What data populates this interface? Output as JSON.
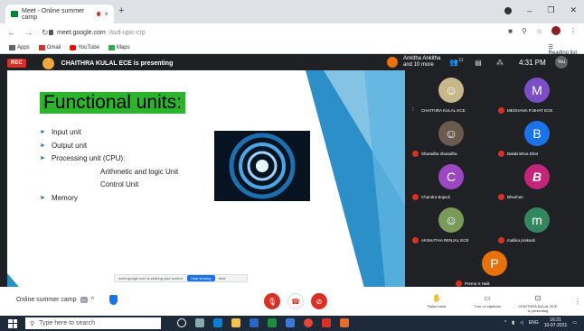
{
  "browser": {
    "tab_title": "Meet - Online summer camp",
    "url": "meet.google.com",
    "url_path": "/svd-upic-crp",
    "bookmarks": [
      {
        "label": "Apps",
        "icon": "apps-grid-icon",
        "color": "#5f6368"
      },
      {
        "label": "Gmail",
        "icon": "gmail-icon",
        "color": "#d93025"
      },
      {
        "label": "YouTube",
        "icon": "youtube-icon",
        "color": "#ff0000"
      },
      {
        "label": "Maps",
        "icon": "maps-icon",
        "color": "#34a853"
      }
    ],
    "reading_list": "Reading list"
  },
  "meet": {
    "rec_badge": "REC",
    "presenting_text": "CHAITHRA KULAL ECE is presenting",
    "participants_summary_line1": "Ankitha Ankitha",
    "participants_summary_line2": "and 10 more",
    "people_count": "11",
    "time": "4:31 PM",
    "self_label": "You"
  },
  "slide": {
    "title": "Functional units:",
    "bullets": [
      {
        "text": "Input unit",
        "level": 1
      },
      {
        "text": "Output unit",
        "level": 1
      },
      {
        "text": "Processing unit (CPU):",
        "level": 1
      },
      {
        "text": "Arithmetic and logic Unit",
        "level": 2
      },
      {
        "text": "Control Unit",
        "level": 2
      },
      {
        "text": "Memory",
        "level": 1
      }
    ],
    "share_text": "meet.google.com is sharing your screen.",
    "stop_sharing": "Stop sharing",
    "hide": "Hide"
  },
  "participants": [
    {
      "name": "CHAITHRA KULAL ECE",
      "initial": "",
      "color": "#c7b88a",
      "muted": false,
      "photo": true
    },
    {
      "name": "MEGHANA R BHAT ECE",
      "initial": "M",
      "color": "#7b4ec7",
      "muted": true,
      "photo": false
    },
    {
      "name": "Sharadha sharadha",
      "initial": "",
      "color": "#6b5a4e",
      "muted": true,
      "photo": true
    },
    {
      "name": "Balakrishna Bhat",
      "initial": "B",
      "color": "#1a73e8",
      "muted": true,
      "photo": false
    },
    {
      "name": "Chandra Bojack",
      "initial": "C",
      "color": "#9c47c2",
      "muted": true,
      "photo": false
    },
    {
      "name": "Bhushan",
      "initial": "B",
      "color": "#c2257a",
      "muted": true,
      "photo": false
    },
    {
      "name": "AKSHATHA RENJAL ECE",
      "initial": "",
      "color": "#7a9a5a",
      "muted": true,
      "photo": true
    },
    {
      "name": "mallika prakash",
      "initial": "m",
      "color": "#33875e",
      "muted": true,
      "photo": false
    },
    {
      "name": "Prema S Naik",
      "initial": "P",
      "color": "#e8710a",
      "muted": true,
      "photo": false
    }
  ],
  "bottombar": {
    "meeting_name": "Online summer camp",
    "raise_hand": "Raise hand",
    "captions": "Turn on captions",
    "presenter_line1": "CHAITHRA KULAL ECE",
    "presenter_line2": "is presenting"
  },
  "taskbar": {
    "search_placeholder": "Type here to search",
    "language": "ENG",
    "clock_time": "16:31",
    "clock_date": "10-07-2021"
  }
}
